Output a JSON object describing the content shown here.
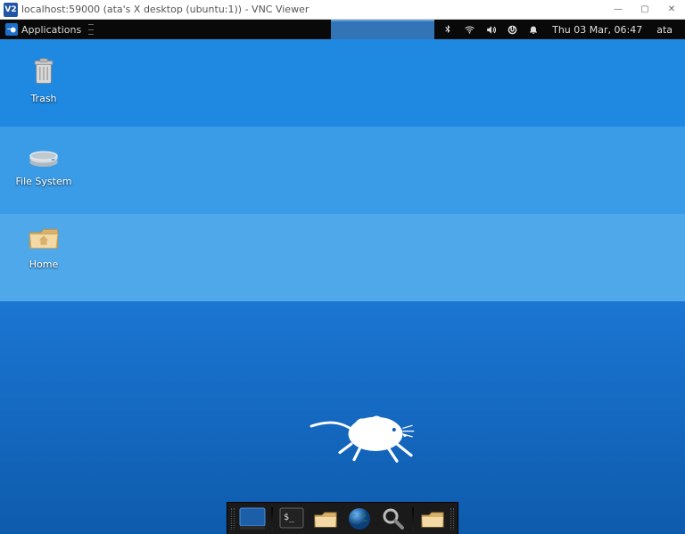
{
  "vnc_window": {
    "icon_label": "V2",
    "title": "localhost:59000 (ata's X desktop (ubuntu:1)) - VNC Viewer",
    "buttons": {
      "minimize": "—",
      "maximize": "▢",
      "close": "✕"
    }
  },
  "top_panel": {
    "applications": "Applications",
    "clock": "Thu 03 Mar, 06:47",
    "user": "ata",
    "tray_icons": [
      "bluetooth-icon",
      "wifi-icon",
      "volume-icon",
      "power-icon",
      "notification-icon"
    ]
  },
  "desktop_icons": [
    {
      "name": "trash-icon",
      "label": "Trash"
    },
    {
      "name": "filesystem-icon",
      "label": "File System"
    },
    {
      "name": "home-icon",
      "label": "Home"
    }
  ],
  "dock": {
    "items": [
      {
        "name": "show-desktop-icon",
        "label": "Show Desktop"
      },
      {
        "name": "terminal-icon",
        "label": "Terminal"
      },
      {
        "name": "file-manager-icon",
        "label": "File Manager"
      },
      {
        "name": "web-browser-icon",
        "label": "Web Browser"
      },
      {
        "name": "app-finder-icon",
        "label": "Application Finder"
      },
      {
        "name": "home-folder-icon",
        "label": "Home Folder"
      }
    ]
  },
  "colors": {
    "panel_bg": "#090909",
    "desktop_top": "#1f88e0",
    "desktop_bottom": "#0e5bad",
    "active_task": "#3274b5"
  }
}
